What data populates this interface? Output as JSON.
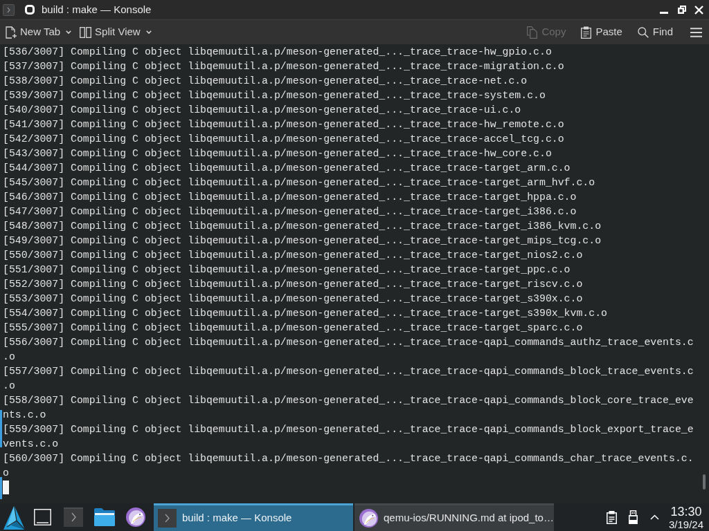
{
  "window": {
    "title": "build : make — Konsole"
  },
  "toolbar": {
    "left": [
      {
        "label": "New Tab"
      },
      {
        "label": "Split View"
      }
    ],
    "right": [
      {
        "label": "Copy",
        "disabled": true
      },
      {
        "label": "Paste",
        "disabled": false
      },
      {
        "label": "Find",
        "disabled": false
      }
    ]
  },
  "terminal": {
    "lines": [
      "[536/3007] Compiling C object libqemuutil.a.p/meson-generated_..._trace_trace-hw_gpio.c.o",
      "[537/3007] Compiling C object libqemuutil.a.p/meson-generated_..._trace_trace-migration.c.o",
      "[538/3007] Compiling C object libqemuutil.a.p/meson-generated_..._trace_trace-net.c.o",
      "[539/3007] Compiling C object libqemuutil.a.p/meson-generated_..._trace_trace-system.c.o",
      "[540/3007] Compiling C object libqemuutil.a.p/meson-generated_..._trace_trace-ui.c.o",
      "[541/3007] Compiling C object libqemuutil.a.p/meson-generated_..._trace_trace-hw_remote.c.o",
      "[542/3007] Compiling C object libqemuutil.a.p/meson-generated_..._trace_trace-accel_tcg.c.o",
      "[543/3007] Compiling C object libqemuutil.a.p/meson-generated_..._trace_trace-hw_core.c.o",
      "[544/3007] Compiling C object libqemuutil.a.p/meson-generated_..._trace_trace-target_arm.c.o",
      "[545/3007] Compiling C object libqemuutil.a.p/meson-generated_..._trace_trace-target_arm_hvf.c.o",
      "[546/3007] Compiling C object libqemuutil.a.p/meson-generated_..._trace_trace-target_hppa.c.o",
      "[547/3007] Compiling C object libqemuutil.a.p/meson-generated_..._trace_trace-target_i386.c.o",
      "[548/3007] Compiling C object libqemuutil.a.p/meson-generated_..._trace_trace-target_i386_kvm.c.o",
      "[549/3007] Compiling C object libqemuutil.a.p/meson-generated_..._trace_trace-target_mips_tcg.c.o",
      "[550/3007] Compiling C object libqemuutil.a.p/meson-generated_..._trace_trace-target_nios2.c.o",
      "[551/3007] Compiling C object libqemuutil.a.p/meson-generated_..._trace_trace-target_ppc.c.o",
      "[552/3007] Compiling C object libqemuutil.a.p/meson-generated_..._trace_trace-target_riscv.c.o",
      "[553/3007] Compiling C object libqemuutil.a.p/meson-generated_..._trace_trace-target_s390x.c.o",
      "[554/3007] Compiling C object libqemuutil.a.p/meson-generated_..._trace_trace-target_s390x_kvm.c.o",
      "[555/3007] Compiling C object libqemuutil.a.p/meson-generated_..._trace_trace-target_sparc.c.o",
      "[556/3007] Compiling C object libqemuutil.a.p/meson-generated_..._trace_trace-qapi_commands_authz_trace_events.c.o",
      "[557/3007] Compiling C object libqemuutil.a.p/meson-generated_..._trace_trace-qapi_commands_block_trace_events.c.o",
      "[558/3007] Compiling C object libqemuutil.a.p/meson-generated_..._trace_trace-qapi_commands_block_core_trace_events.c.o",
      "[559/3007] Compiling C object libqemuutil.a.p/meson-generated_..._trace_trace-qapi_commands_block_export_trace_events.c.o",
      "[560/3007] Compiling C object libqemuutil.a.p/meson-generated_..._trace_trace-qapi_commands_char_trace_events.c.o"
    ]
  },
  "taskbar": {
    "tasks": [
      {
        "label": "build : make — Konsole",
        "selected": true
      },
      {
        "label": "qemu-ios/RUNNING.md at ipod_to…",
        "selected": false
      }
    ],
    "clock": {
      "time": "13:30",
      "date": "3/19/24"
    }
  }
}
